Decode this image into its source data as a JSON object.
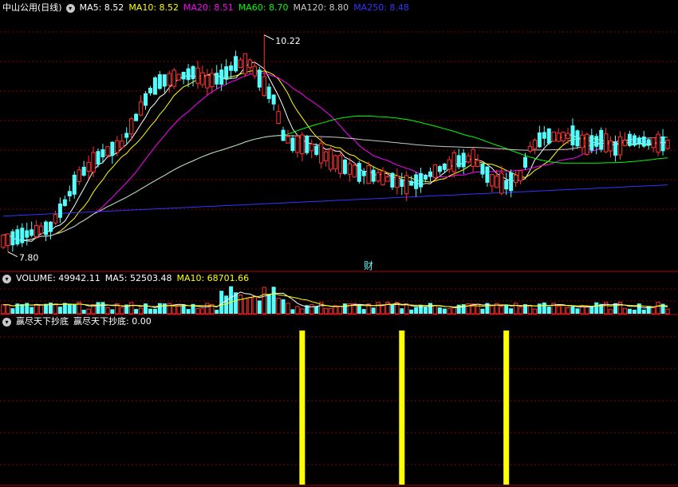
{
  "main": {
    "title": "中山公用(日线)",
    "ma": [
      {
        "label": "MA5: 8.52",
        "color": "#ffffff"
      },
      {
        "label": "MA10: 8.52",
        "color": "#ffff00"
      },
      {
        "label": "MA20: 8.51",
        "color": "#ff00ff"
      },
      {
        "label": "MA60: 8.70",
        "color": "#00ff00"
      },
      {
        "label": "MA120: 8.80",
        "color": "#c8c8c8"
      },
      {
        "label": "MA250: 8.48",
        "color": "#3333ff"
      }
    ],
    "high_label": "10.22",
    "low_label": "7.80",
    "marker": "财"
  },
  "volume": {
    "label": "VOLUME: 49942.11",
    "ma5": "MA5: 52503.48",
    "ma10": "MA10: 68701.66"
  },
  "indicator": {
    "name": "赢尽天下抄底",
    "value_label": "赢尽天下抄底: 0.00"
  },
  "colors": {
    "up": "#ff3232",
    "down": "#54ffff",
    "grid": "#8b0000",
    "border": "#b40000",
    "signal": "#ffff00",
    "marker": "#54ffff"
  },
  "chart_data": {
    "type": "candlestick",
    "price_range": [
      7.6,
      10.45
    ],
    "high": 10.22,
    "low": 7.8,
    "signal_bars": [
      63,
      84,
      106
    ]
  }
}
